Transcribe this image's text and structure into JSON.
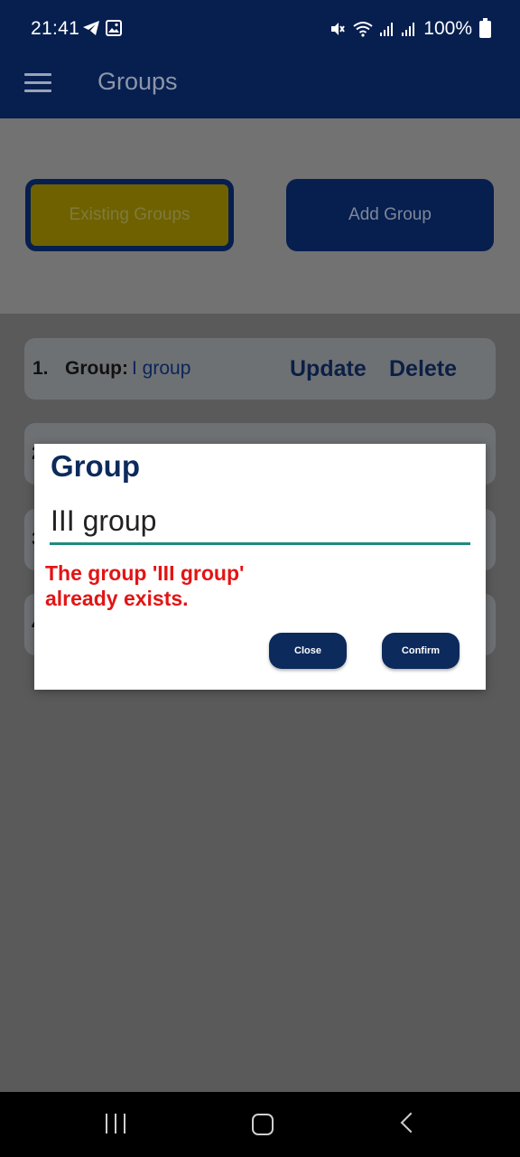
{
  "status_bar": {
    "time": "21:41",
    "battery_text": "100%",
    "icons": [
      "telegram-icon",
      "gallery-icon",
      "mute-icon",
      "wifi-icon",
      "signal-icon",
      "signal-icon",
      "battery-icon"
    ]
  },
  "app_bar": {
    "title": "Groups",
    "menu_icon": "hamburger-menu-icon"
  },
  "tabs": {
    "existing_label": "Existing Groups",
    "add_label": "Add Group"
  },
  "list": {
    "items": [
      {
        "number": "1.",
        "label": "Group:",
        "value": "I group",
        "update_label": "Update",
        "delete_label": "Delete"
      },
      {
        "number": "2"
      },
      {
        "number": "3"
      },
      {
        "number": "4"
      }
    ]
  },
  "dialog": {
    "title": "Group",
    "input_value": "III group",
    "error_message": "The group 'III group' already exists.",
    "close_label": "Close",
    "confirm_label": "Confirm"
  },
  "colors": {
    "primary": "#061f4f",
    "accent_yellow": "#f0d000",
    "error": "#e31414",
    "input_underline": "#1f8b7c"
  }
}
